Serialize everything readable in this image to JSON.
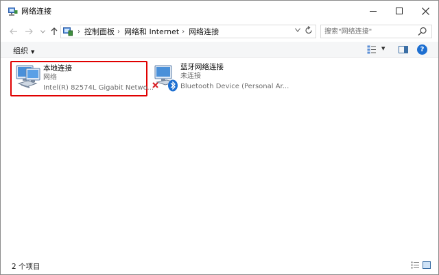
{
  "window": {
    "title": "网络连接"
  },
  "title_icon": "network-connections-icon",
  "nav": {
    "back_icon": "arrow-left-icon",
    "forward_icon": "arrow-right-icon",
    "up_icon": "arrow-up-icon"
  },
  "address": {
    "breadcrumbs": [
      {
        "label": "控制面板"
      },
      {
        "label": "网络和 Internet"
      },
      {
        "label": "网络连接"
      }
    ]
  },
  "search": {
    "placeholder": "搜索\"网络连接\""
  },
  "toolbar": {
    "organize_label": "组织"
  },
  "connections": [
    {
      "name": "本地连接",
      "status": "网络",
      "device": "Intel(R) 82574L Gigabit Netwo...",
      "icon": "ethernet-adapter-icon",
      "highlighted": true
    },
    {
      "name": "蓝牙网络连接",
      "status": "未连接",
      "device": "Bluetooth Device (Personal Ar...",
      "icon": "bluetooth-adapter-icon",
      "highlighted": false
    }
  ],
  "status_bar": {
    "item_count": "2 个项目"
  },
  "colors": {
    "highlight_border": "#e00000",
    "accent": "#1d6fd1",
    "disconnected_x": "#d9262c"
  }
}
